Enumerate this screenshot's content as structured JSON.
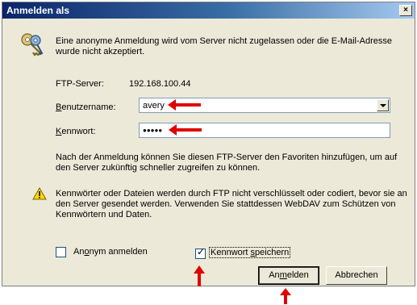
{
  "dialog": {
    "title": "Anmelden als",
    "close_glyph": "×",
    "intro_text": "Eine anonyme Anmeldung wird vom Server nicht zugelassen oder die E-Mail-Adresse wurde nicht akzeptiert.",
    "server_label": "FTP-Server:",
    "server_value": "192.168.100.44",
    "username_label_pre": "",
    "username_label_u": "B",
    "username_label_post": "enutzername:",
    "username_value": "avery",
    "password_label_pre": "",
    "password_label_u": "K",
    "password_label_post": "ennwort:",
    "password_mask": "●●●●●",
    "info_text": "Nach der Anmeldung können Sie diesen FTP-Server den Favoriten hinzufügen, um auf den Server zukünftig schneller zugreifen zu können.",
    "warning_text": "Kennwörter oder Dateien werden durch FTP nicht verschlüsselt oder codiert, bevor sie an den Server gesendet werden. Verwenden Sie stattdessen WebDAV zum Schützen von Kennwörtern und Daten.",
    "anon_label_pre": "An",
    "anon_label_u": "o",
    "anon_label_post": "nym anmelden",
    "anon_checked": false,
    "save_pw_label_pre": "Kennwort ",
    "save_pw_label_u": "s",
    "save_pw_label_post": "peichern",
    "save_pw_checked": true,
    "login_pre": "An",
    "login_u": "m",
    "login_post": "elden",
    "cancel_label": "Abbrechen"
  },
  "colors": {
    "annotation_arrow": "#e00000",
    "title_bar": "#0a246a",
    "dialog_bg": "#ece9d8"
  },
  "icons": {
    "header": "keys-icon",
    "warning": "warning-icon"
  }
}
